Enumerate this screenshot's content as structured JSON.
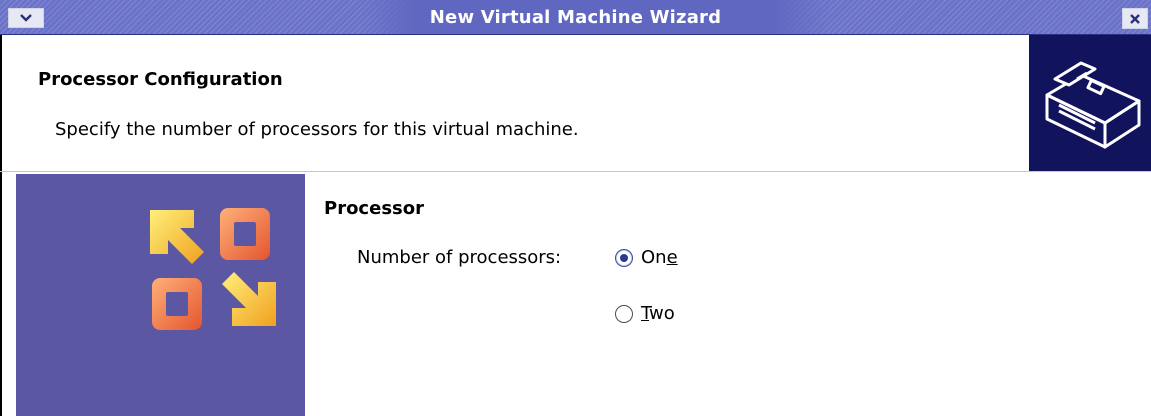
{
  "window": {
    "title": "New Virtual Machine Wizard",
    "menu_icon": "chevron-down-icon",
    "close_icon": "close-icon"
  },
  "header": {
    "title": "Processor Configuration",
    "subtitle": "Specify the number of processors for this virtual machine.",
    "graphic_icon": "hardware-box-icon"
  },
  "side_panel": {
    "logo_icon": "vmware-logo-icon",
    "background_color": "#5c57a3"
  },
  "processor": {
    "section_title": "Processor",
    "label": "Number of processors:",
    "options": [
      {
        "label_before": "On",
        "mnemonic": "e",
        "label_after": "",
        "selected": true
      },
      {
        "label_before": "",
        "mnemonic": "T",
        "label_after": "wo",
        "selected": false
      }
    ]
  },
  "colors": {
    "titlebar": "#6b73c9",
    "header_graphic_bg": "#11135c",
    "radio_selected": "#2a3a8c"
  }
}
